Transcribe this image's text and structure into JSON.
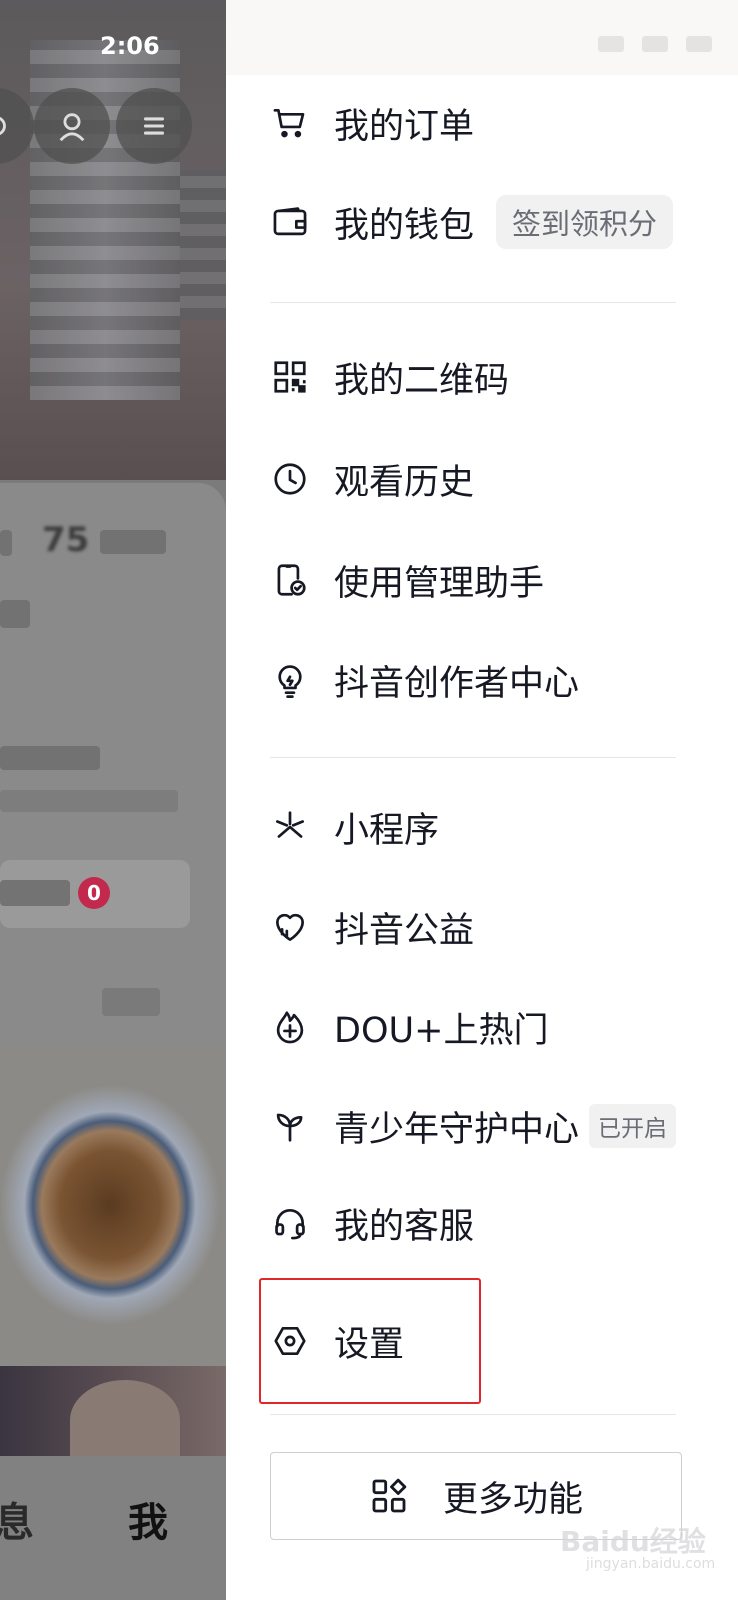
{
  "status_bar": {
    "time": "2:06"
  },
  "background": {
    "nav": {
      "messages_label": "息",
      "me_label": "我"
    },
    "badge_count": "0",
    "count_text": "75"
  },
  "menu": {
    "items": [
      {
        "label": "我的订单",
        "icon": "cart-icon"
      },
      {
        "label": "我的钱包",
        "icon": "wallet-icon",
        "tag": "签到领积分"
      },
      {
        "label": "我的二维码",
        "icon": "qrcode-icon"
      },
      {
        "label": "观看历史",
        "icon": "clock-icon"
      },
      {
        "label": "使用管理助手",
        "icon": "phone-check-icon"
      },
      {
        "label": "抖音创作者中心",
        "icon": "lightbulb-icon"
      },
      {
        "label": "小程序",
        "icon": "mini-program-icon"
      },
      {
        "label": "抖音公益",
        "icon": "heart-icon"
      },
      {
        "label": "DOU+上热门",
        "icon": "flame-plus-icon"
      },
      {
        "label": "青少年守护中心",
        "icon": "sprout-icon",
        "tag": "已开启"
      },
      {
        "label": "我的客服",
        "icon": "headset-icon"
      },
      {
        "label": "设置",
        "icon": "settings-hexagon-icon"
      }
    ],
    "more_button": {
      "label": "更多功能",
      "icon": "grid-diamond-icon"
    }
  },
  "watermark": {
    "text": "Baidu经验",
    "sub": "jingyan.baidu.com"
  },
  "colors": {
    "highlight": "#e0282c",
    "text": "#161823",
    "badge": "#c2294d"
  }
}
